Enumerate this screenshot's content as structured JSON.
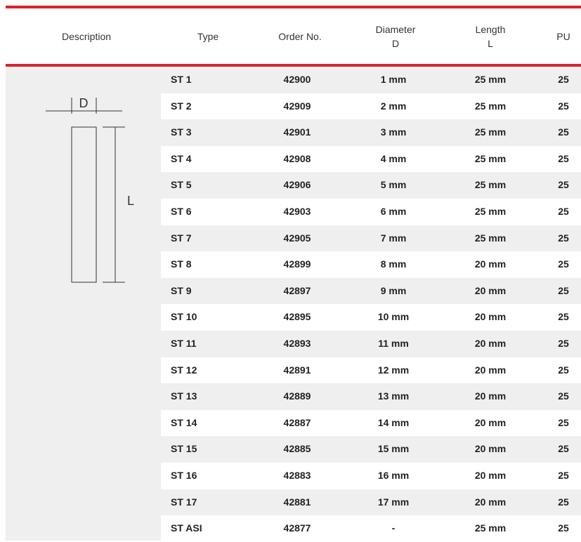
{
  "header": {
    "description": "Description",
    "type": "Type",
    "order_no": "Order No.",
    "diameter": "Diameter",
    "diameter_symbol": "D",
    "length": "Length",
    "length_symbol": "L",
    "pu": "PU"
  },
  "drawing": {
    "d_label": "D",
    "l_label": "L"
  },
  "rows": [
    {
      "type": "ST 1",
      "order": "42900",
      "diameter": "1 mm",
      "length": "25 mm",
      "pu": "25"
    },
    {
      "type": "ST 2",
      "order": "42909",
      "diameter": "2 mm",
      "length": "25 mm",
      "pu": "25"
    },
    {
      "type": "ST 3",
      "order": "42901",
      "diameter": "3 mm",
      "length": "25 mm",
      "pu": "25"
    },
    {
      "type": "ST 4",
      "order": "42908",
      "diameter": "4 mm",
      "length": "25 mm",
      "pu": "25"
    },
    {
      "type": "ST 5",
      "order": "42906",
      "diameter": "5 mm",
      "length": "25 mm",
      "pu": "25"
    },
    {
      "type": "ST 6",
      "order": "42903",
      "diameter": "6 mm",
      "length": "25 mm",
      "pu": "25"
    },
    {
      "type": "ST 7",
      "order": "42905",
      "diameter": "7 mm",
      "length": "25 mm",
      "pu": "25"
    },
    {
      "type": "ST 8",
      "order": "42899",
      "diameter": "8 mm",
      "length": "20 mm",
      "pu": "25"
    },
    {
      "type": "ST 9",
      "order": "42897",
      "diameter": "9 mm",
      "length": "20 mm",
      "pu": "25"
    },
    {
      "type": "ST 10",
      "order": "42895",
      "diameter": "10 mm",
      "length": "20 mm",
      "pu": "25"
    },
    {
      "type": "ST 11",
      "order": "42893",
      "diameter": "11 mm",
      "length": "20 mm",
      "pu": "25"
    },
    {
      "type": "ST 12",
      "order": "42891",
      "diameter": "12 mm",
      "length": "20 mm",
      "pu": "25"
    },
    {
      "type": "ST 13",
      "order": "42889",
      "diameter": "13 mm",
      "length": "20 mm",
      "pu": "25"
    },
    {
      "type": "ST 14",
      "order": "42887",
      "diameter": "14 mm",
      "length": "20 mm",
      "pu": "25"
    },
    {
      "type": "ST 15",
      "order": "42885",
      "diameter": "15 mm",
      "length": "20 mm",
      "pu": "25"
    },
    {
      "type": "ST 16",
      "order": "42883",
      "diameter": "16 mm",
      "length": "20 mm",
      "pu": "25"
    },
    {
      "type": "ST 17",
      "order": "42881",
      "diameter": "17 mm",
      "length": "20 mm",
      "pu": "25"
    },
    {
      "type": "ST ASI",
      "order": "42877",
      "diameter": "-",
      "length": "25 mm",
      "pu": "25"
    }
  ],
  "colors": {
    "accent": "#d9232e",
    "row_shade": "#efefef"
  }
}
